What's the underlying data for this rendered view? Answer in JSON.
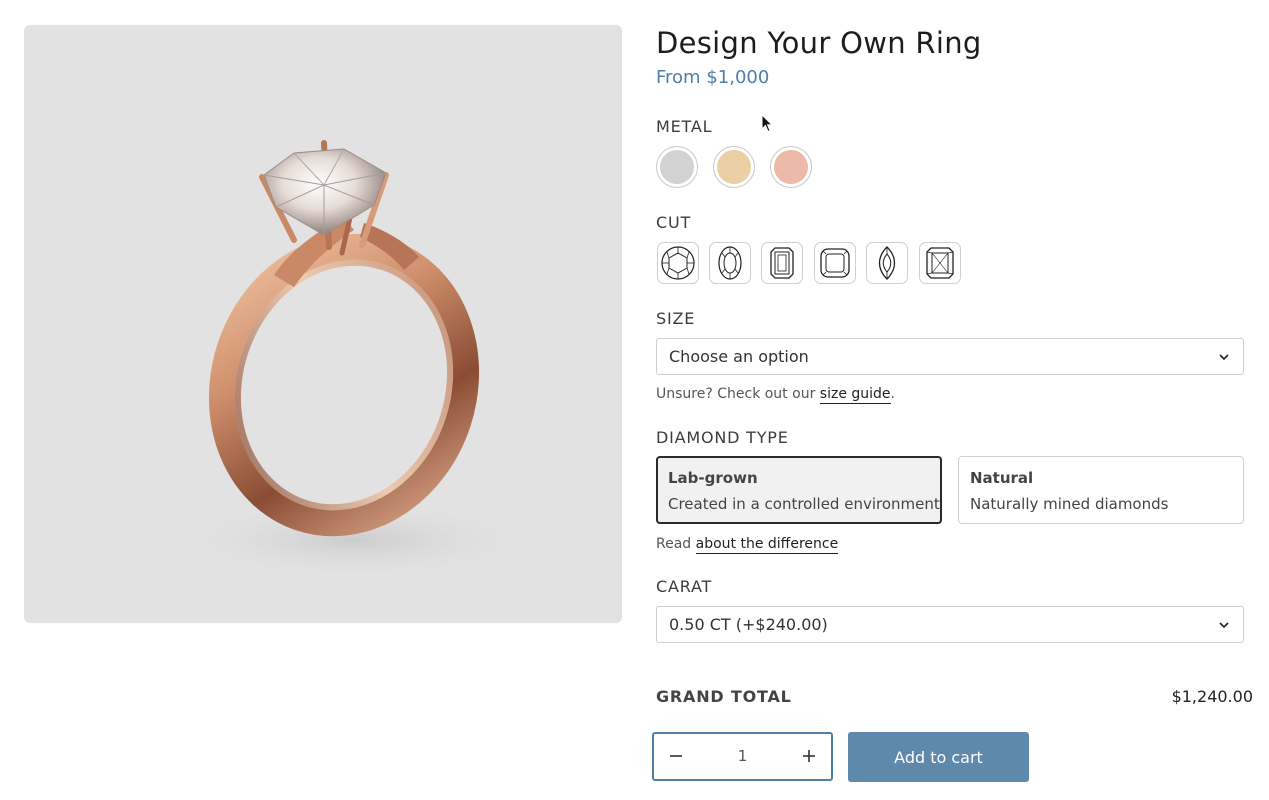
{
  "product": {
    "title": "Design Your Own Ring",
    "price_from": "From $1,000",
    "image_alt": "rose-gold-solitaire-ring"
  },
  "metal": {
    "label": "METAL",
    "options": [
      {
        "name": "white-gold",
        "color": "#d2d2d2"
      },
      {
        "name": "yellow-gold",
        "color": "#e9cfa3"
      },
      {
        "name": "rose-gold",
        "color": "#ecbaa9"
      }
    ]
  },
  "cut": {
    "label": "CUT",
    "options": [
      "round-cut-icon",
      "oval-cut-icon",
      "emerald-cut-icon",
      "cushion-cut-icon",
      "marquise-cut-icon",
      "radiant-cut-icon"
    ]
  },
  "size": {
    "label": "SIZE",
    "selected": "Choose an option",
    "hint_prefix": "Unsure? Check out our ",
    "hint_link": "size guide",
    "hint_suffix": "."
  },
  "diamond_type": {
    "label": "DIAMOND TYPE",
    "options": [
      {
        "title": "Lab-grown",
        "desc": "Created in a controlled environment",
        "selected": true
      },
      {
        "title": "Natural",
        "desc": "Naturally mined diamonds",
        "selected": false
      }
    ],
    "read_prefix": "Read ",
    "read_link": "about the difference"
  },
  "carat": {
    "label": "CARAT",
    "selected": "0.50 CT (+$240.00)"
  },
  "totals": {
    "label": "GRAND TOTAL",
    "value": "$1,240.00"
  },
  "quantity": {
    "value": "1"
  },
  "actions": {
    "add_to_cart": "Add to cart"
  },
  "colors": {
    "accent": "#4e7fa8",
    "button": "#5f88ad",
    "rose_gold": "#c8876a",
    "background_image": "#e2e2e2"
  }
}
